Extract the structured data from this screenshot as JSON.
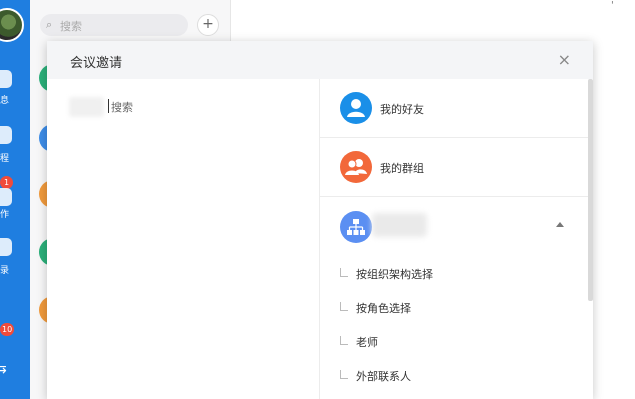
{
  "rail": {
    "badges": [
      "1",
      "10"
    ],
    "labels": [
      "息",
      "程",
      "作",
      "录"
    ]
  },
  "conversations": {
    "search_placeholder": "搜索",
    "add_symbol": "+"
  },
  "modal": {
    "title": "会议邀请",
    "close_symbol": "×",
    "left_search_placeholder": "搜索",
    "options": [
      {
        "label": "我的好友",
        "icon": "person-icon",
        "color": "#1a8fe8"
      },
      {
        "label": "我的群组",
        "icon": "group-icon",
        "color": "#f2683a"
      },
      {
        "label": "",
        "icon": "org-tree-icon",
        "color": "#5b8ff2",
        "expanded": true
      }
    ],
    "org_sub_options": [
      "按组织架构选择",
      "按角色选择",
      "老师",
      "外部联系人"
    ]
  }
}
